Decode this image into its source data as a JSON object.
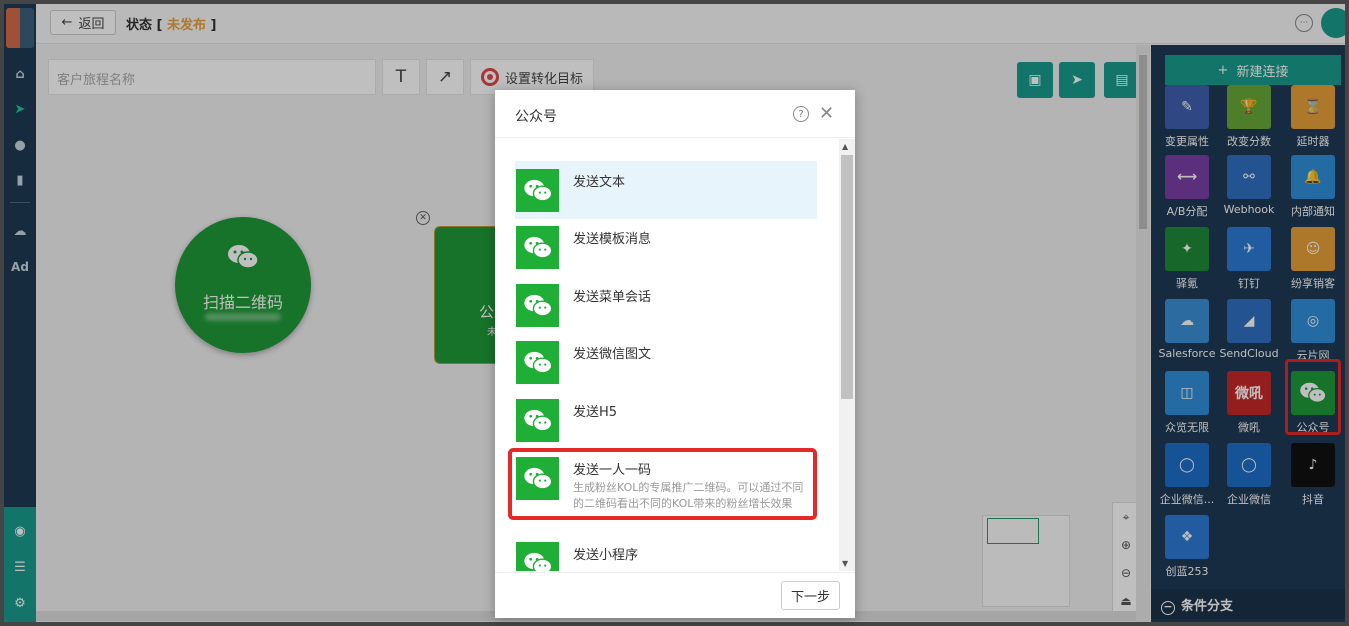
{
  "topbar": {
    "back_label": "返回",
    "status_prefix": "状态 [ ",
    "status_value": "未发布",
    "status_suffix": " ]"
  },
  "canvas": {
    "journey_name_placeholder": "客户旅程名称",
    "text_tool": "T",
    "arrow_tool": "↗",
    "goal_label": "设置转化目标",
    "node_scan_label": "扫描二维码",
    "node_wx_label": "公众号",
    "node_wx_sub": "未配置"
  },
  "zoom": [
    "⌖",
    "⊕",
    "⊖",
    "⏏"
  ],
  "panel": {
    "new_connection": "新建连接",
    "tiles": [
      {
        "label": "变更属性",
        "color": "#3f5fae",
        "glyph": "✎"
      },
      {
        "label": "改变分数",
        "color": "#6aa83a",
        "glyph": "🏆"
      },
      {
        "label": "延时器",
        "color": "#e8a13a",
        "glyph": "⌛"
      },
      {
        "label": "A/B分配",
        "color": "#7b3fa6",
        "glyph": "⟷"
      },
      {
        "label": "Webhook",
        "color": "#2f6fc0",
        "glyph": "⚯"
      },
      {
        "label": "内部通知",
        "color": "#2f8fd8",
        "glyph": "🔔"
      },
      {
        "label": "驿氪",
        "color": "#1f8a3a",
        "glyph": "✦"
      },
      {
        "label": "钉钉",
        "color": "#2d7ad6",
        "glyph": "✈"
      },
      {
        "label": "纷享销客",
        "color": "#e8a13a",
        "glyph": "☺"
      },
      {
        "label": "Salesforce",
        "color": "#3a8fd6",
        "glyph": "☁"
      },
      {
        "label": "SendCloud",
        "color": "#2f6fc0",
        "glyph": "◢"
      },
      {
        "label": "云片网",
        "color": "#2f8fd8",
        "glyph": "◎"
      },
      {
        "label": "众览无限",
        "color": "#2f8fd8",
        "glyph": "◫"
      },
      {
        "label": "微吼",
        "color": "#c62828",
        "glyph": "微吼"
      },
      {
        "label": "公众号",
        "color": "#1f9a39",
        "glyph": "wx"
      },
      {
        "label": "企业微信...",
        "color": "#1e6fc8",
        "glyph": "◯"
      },
      {
        "label": "企业微信",
        "color": "#1e6fc8",
        "glyph": "◯"
      },
      {
        "label": "抖音",
        "color": "#111111",
        "glyph": "♪"
      },
      {
        "label": "创蓝253",
        "color": "#2f7ad6",
        "glyph": "❖"
      }
    ],
    "condition_branch": "条件分支"
  },
  "modal": {
    "title": "公众号",
    "items": [
      {
        "name": "发送文本",
        "desc": ""
      },
      {
        "name": "发送模板消息",
        "desc": ""
      },
      {
        "name": "发送菜单会话",
        "desc": ""
      },
      {
        "name": "发送微信图文",
        "desc": ""
      },
      {
        "name": "发送H5",
        "desc": ""
      },
      {
        "name": "发送一人一码",
        "desc": "生成粉丝KOL的专属推广二维码。可以通过不同的二维码看出不同的KOL带来的粉丝增长效果"
      },
      {
        "name": "发送小程序",
        "desc": ""
      }
    ],
    "next_label": "下一步"
  },
  "colors": {
    "accent": "#1a9b8c",
    "wechat_green": "#1fae36",
    "highlight_red": "#e52828",
    "warning": "#e6a23c"
  }
}
